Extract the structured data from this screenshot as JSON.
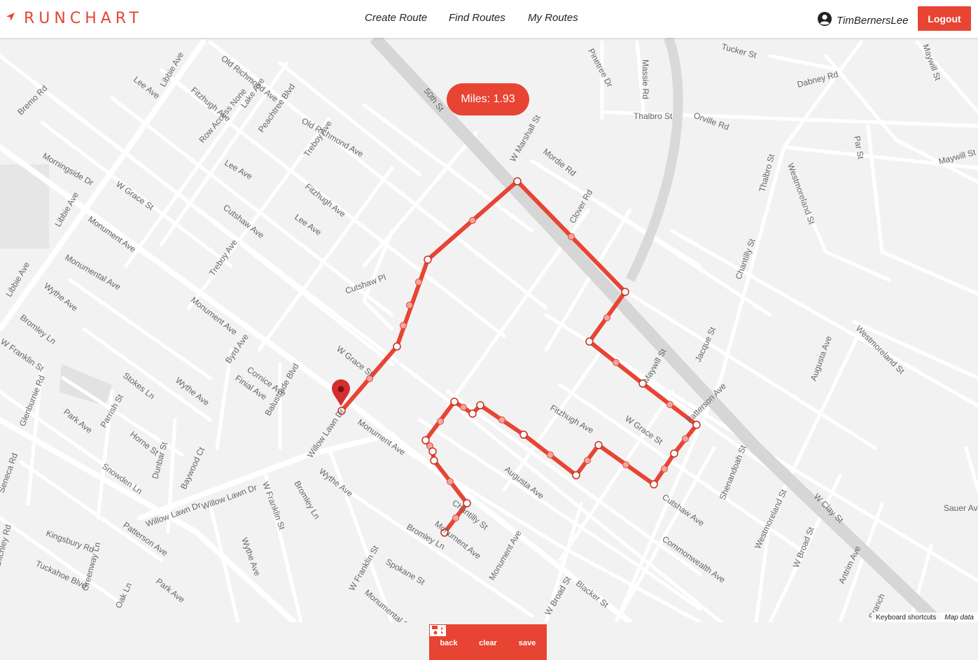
{
  "app": {
    "brand": "RUNCHART"
  },
  "nav": {
    "links": [
      "Create Route",
      "Find Routes",
      "My Routes"
    ],
    "username": "TimBernersLee",
    "logout_label": "Logout"
  },
  "map": {
    "miles_label": "Miles: 1.93",
    "toolbar": {
      "back": "back",
      "clear": "clear",
      "save": "save"
    },
    "attribution": {
      "shortcuts": "Keyboard shortcuts",
      "map_data": "Map data"
    },
    "route_color": "#e84434",
    "streets": [
      "Lee Ave",
      "Libbie Ave",
      "Old Richmond Ave",
      "Fitzhugh Ave",
      "Lake Ave",
      "Bremo Rd",
      "Row Access None",
      "Peachtree Blvd",
      "Old Richmond Ave",
      "Lee Ave",
      "Treboy Ave",
      "Fitzhugh Ave",
      "Morningside Dr",
      "W Grace St",
      "Libbie Ave",
      "Monument Ave",
      "Monumental Ave",
      "Cutshaw Ave",
      "Lee Ave",
      "Wythe Ave",
      "Libbie Ave",
      "Bromley Ln",
      "W Franklin St",
      "Monument Ave",
      "Treboy Ave",
      "Cutshaw Pl",
      "W Grace St",
      "Byrd Ave",
      "Cornice Ave",
      "Finial Ave",
      "Stokes Ln",
      "Wythe Ave",
      "Balustrade Blvd",
      "Glenburnie Rd",
      "Park Ave",
      "Parrish St",
      "Horne St",
      "Snowden Ln",
      "Dunbar St",
      "Baywood Ct",
      "Willow Lawn Dr",
      "Willow Lawn Dr",
      "Willow Lawn Dr",
      "Monument Ave",
      "Wythe Ave",
      "Bromley Ln",
      "W Franklin St",
      "Patterson Ave",
      "Seneca Rd",
      "Kingsbury Rd",
      "Ditchley Rd",
      "Tuckahoe Blvd",
      "Greenway Ln",
      "Oak Ln",
      "Park Ave",
      "Wythe Ave",
      "Bromley Ln",
      "Spokane St",
      "W Franklin St",
      "Monumental St",
      "Monument Ave",
      "Chantilly St",
      "Monument Ave",
      "Blacker St",
      "W Broad St",
      "50th St",
      "W Marshall St",
      "Mordie Rd",
      "Clover Rd",
      "Pinetree Dr",
      "Massie Rd",
      "Thalbro St",
      "Orville Rd",
      "Dabney Rd",
      "Maywill St",
      "Thalbro St",
      "Westmoreland St",
      "Par St",
      "Maywill St",
      "Chantilly St",
      "Maywill St",
      "Jacque St",
      "Westmoreland St",
      "Augusta Ave",
      "Fitzhugh Ave",
      "W Grace St",
      "Augusta Ave",
      "Cutshaw Ave",
      "Commonwealth Ave",
      "Westmoreland St",
      "Shenandoah St",
      "W Broad St",
      "W Clay St",
      "Sauer Ave",
      "Antrim Ave",
      "Branch",
      "Tucker St",
      "Patterson Ave"
    ]
  }
}
